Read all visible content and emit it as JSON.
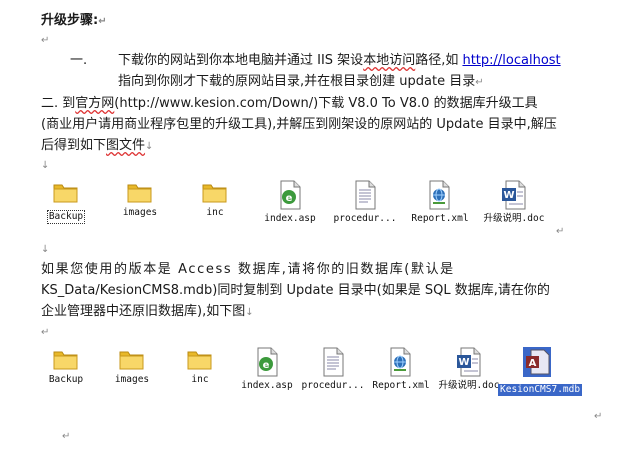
{
  "heading": "升级步骤:",
  "step1": {
    "num": "一.",
    "pre": "下载你的网站到你本地电脑并通过 IIS 架设",
    "squig": "本地访问",
    "mid": "路径,如 ",
    "link": "http://localhost",
    "line2": "指向到你刚才下载的原网站目录,并在根目录创建 update 目录"
  },
  "step2": {
    "pre": "二. 到",
    "squig": "官方网",
    "rest": "(http://www.kesion.com/Down/)下载 V8.0 To V8.0 的数据库升级工具",
    "line2": "(商业用户请用商业程序包里的升级工具),并解压到刚架设的原网站的 Update 目录中,解压",
    "line3a": "后得到如下",
    "line3b": "图文件"
  },
  "files1": [
    {
      "label": "Backup",
      "icon": "folder-icon"
    },
    {
      "label": "images",
      "icon": "folder-icon"
    },
    {
      "label": "inc",
      "icon": "folder-icon"
    },
    {
      "label": "index.asp",
      "icon": "asp-file-icon"
    },
    {
      "label": "procedur...",
      "icon": "text-file-icon"
    },
    {
      "label": "Report.xml",
      "icon": "xml-file-icon"
    },
    {
      "label": "升级说明.doc",
      "icon": "word-doc-icon"
    }
  ],
  "para3": {
    "line1": "如果您使用的版本是 Access 数据库,请将你的旧数据库(默认是",
    "line2": "KS_Data/KesionCMS8.mdb)同时复制到 Update 目录中(如果是 SQL 数据库,请在你的",
    "line3": "企业管理器中还原旧数据库),如下图"
  },
  "files2": [
    {
      "label": "Backup",
      "icon": "folder-icon"
    },
    {
      "label": "images",
      "icon": "folder-icon"
    },
    {
      "label": "inc",
      "icon": "folder-icon"
    },
    {
      "label": "index.asp",
      "icon": "asp-file-icon"
    },
    {
      "label": "procedur...",
      "icon": "text-file-icon"
    },
    {
      "label": "Report.xml",
      "icon": "xml-file-icon"
    },
    {
      "label": "升级说明.doc",
      "icon": "word-doc-icon"
    },
    {
      "label": "KesionCMS7.mdb",
      "icon": "access-mdb-icon"
    }
  ],
  "marks": {
    "return": "↵",
    "down": "↓"
  }
}
